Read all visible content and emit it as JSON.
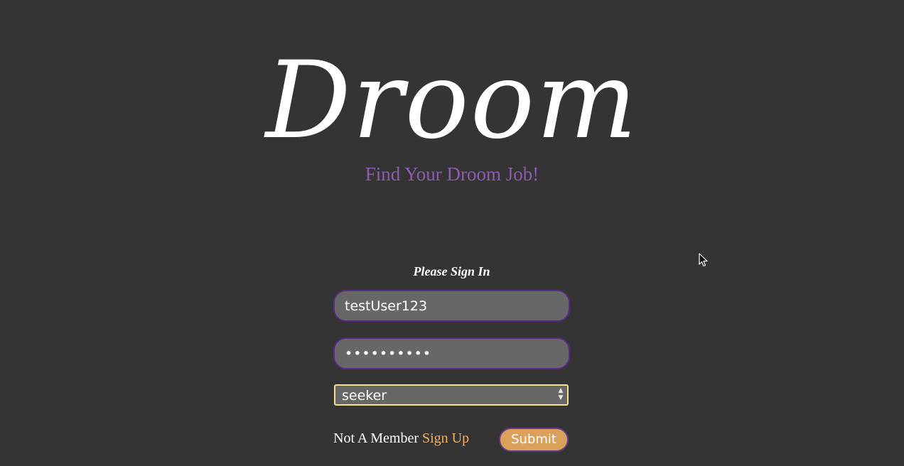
{
  "brand": {
    "logo_text": "Droom",
    "tagline": "Find Your Droom Job!"
  },
  "login_form": {
    "title": "Please Sign In",
    "username_value": "testUser123",
    "password_masked": "••••••••••",
    "role_selected": "seeker",
    "not_member_text": "Not A Member",
    "signup_link": "Sign Up",
    "submit_label": "Submit"
  },
  "colors": {
    "background": "#353435",
    "tagline": "#8a5cb0",
    "input_bg": "#686767",
    "input_border": "#5a2a86",
    "select_border": "#f2e08a",
    "signup_link": "#f0b060",
    "submit_bg": "#dba05a"
  },
  "icons": {
    "select_arrows": "updown-arrows-icon",
    "pointer": "mouse-cursor-icon"
  }
}
